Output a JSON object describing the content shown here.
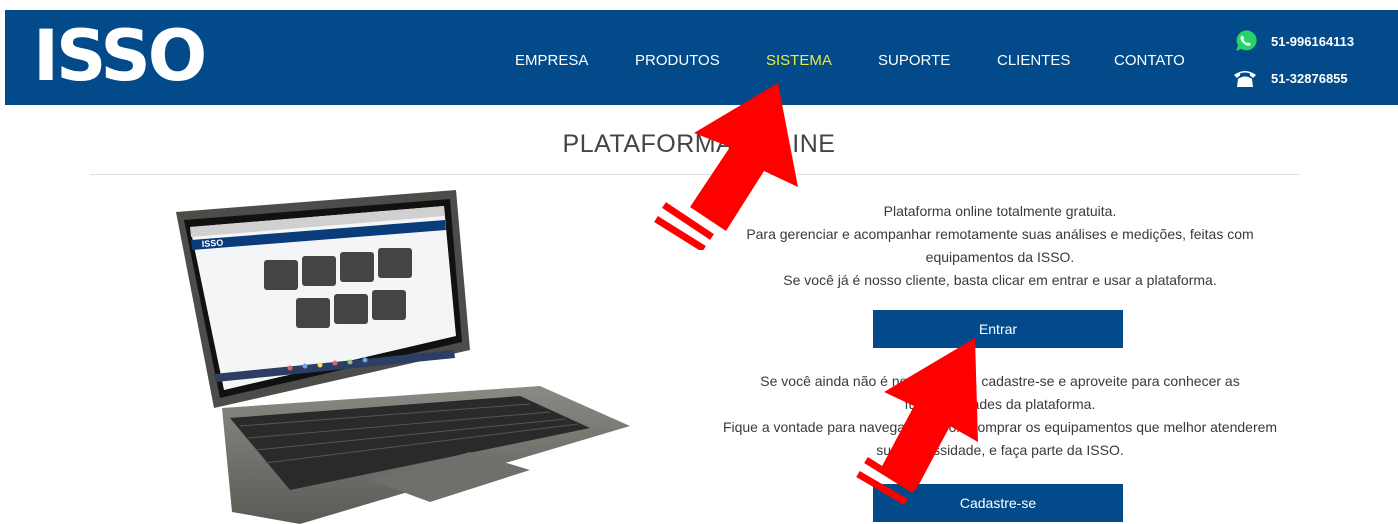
{
  "header": {
    "logo": "ISSO",
    "nav": [
      {
        "label": "EMPRESA"
      },
      {
        "label": "PRODUTOS"
      },
      {
        "label": "SISTEMA",
        "active": true
      },
      {
        "label": "SUPORTE"
      },
      {
        "label": "CLIENTES"
      },
      {
        "label": "CONTATO"
      }
    ],
    "contacts": {
      "whatsapp": "51-996164113",
      "phone": "51-32876855"
    }
  },
  "main": {
    "title": "PLATAFORMA ONLINE",
    "intro": [
      "Plataforma online totalmente gratuita.",
      "Para gerenciar e acompanhar remotamente suas análises e medições, feitas com",
      "equipamentos da ISSO.",
      "Se você já é nosso cliente, basta clicar em entrar e usar a plataforma."
    ],
    "login_button": "Entrar",
    "signup_text": [
      "Se você ainda não é nosso cliente, cadastre-se e aproveite para conhecer as",
      "funcionalidades da plataforma.",
      "Fique a vontade para navegar e depois comprar os equipamentos que melhor atenderem",
      "sua necessidade, e faça parte da ISSO."
    ],
    "signup_button": "Cadastre-se"
  },
  "laptop_screen": {
    "logo": "ISSO"
  },
  "colors": {
    "brand_blue": "#034a8a",
    "nav_active": "#ecec3a",
    "annotation_arrow": "#ff0000"
  }
}
